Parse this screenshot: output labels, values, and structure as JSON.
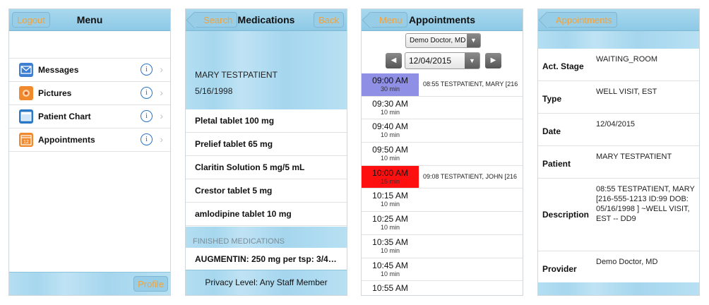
{
  "screen1": {
    "title": "Menu",
    "logout_label": "Logout",
    "profile_label": "Profile",
    "items": [
      {
        "label": "Messages",
        "icon": "envelope-icon",
        "color": "#3e7fd1"
      },
      {
        "label": "Pictures",
        "icon": "pictures-icon",
        "color": "#f08a2c"
      },
      {
        "label": "Patient Chart",
        "icon": "patient-chart-icon",
        "color": "#2b78c6"
      },
      {
        "label": "Appointments",
        "icon": "calendar-icon",
        "color": "#f0892c"
      }
    ],
    "info_glyph": "i",
    "chevron_glyph": "›"
  },
  "screen2": {
    "title": "Medications",
    "search_label": "Search",
    "back_label": "Back",
    "patient_name": "MARY TESTPATIENT",
    "patient_dob": "5/16/1998",
    "medications": [
      "Pletal tablet 100 mg",
      "Prelief tablet 65 mg",
      "Claritin Solution 5 mg/5 mL",
      "Crestor tablet 5 mg",
      "amlodipine tablet 10 mg"
    ],
    "finished_header": "FINISHED MEDICATIONS",
    "finished_item": "AUGMENTIN: 250 mg per tsp: 3/4…",
    "privacy": "Privacy Level: Any Staff Member"
  },
  "screen3": {
    "title": "Appointments",
    "back_label": "Menu",
    "doctor": "Demo Doctor, MD",
    "date": "12/04/2015",
    "prev_glyph": "◀",
    "next_glyph": "▶",
    "dropdown_glyph": "▼",
    "slots": [
      {
        "time": "09:00 AM",
        "duration": "30 min",
        "desc": "08:55 TESTPATIENT, MARY  [216",
        "highlight": "#8f8fe6"
      },
      {
        "time": "09:30 AM",
        "duration": "10 min",
        "desc": "",
        "highlight": ""
      },
      {
        "time": "09:40 AM",
        "duration": "10 min",
        "desc": "",
        "highlight": ""
      },
      {
        "time": "09:50 AM",
        "duration": "10 min",
        "desc": "",
        "highlight": ""
      },
      {
        "time": "10:00 AM",
        "duration": "15 min",
        "desc": "09:08 TESTPATIENT, JOHN  [216",
        "highlight": "#ff1010"
      },
      {
        "time": "10:15 AM",
        "duration": "10 min",
        "desc": "",
        "highlight": ""
      },
      {
        "time": "10:25 AM",
        "duration": "10 min",
        "desc": "",
        "highlight": ""
      },
      {
        "time": "10:35 AM",
        "duration": "10 min",
        "desc": "",
        "highlight": ""
      },
      {
        "time": "10:45 AM",
        "duration": "10 min",
        "desc": "",
        "highlight": ""
      },
      {
        "time": "10:55 AM",
        "duration": "",
        "desc": "",
        "highlight": ""
      }
    ]
  },
  "screen4": {
    "back_label": "Appointments",
    "rows": [
      {
        "label": "Act. Stage",
        "value": "WAITING_ROOM"
      },
      {
        "label": "Type",
        "value": "WELL VISIT, EST"
      },
      {
        "label": "Date",
        "value": "12/04/2015"
      },
      {
        "label": "Patient",
        "value": "MARY TESTPATIENT"
      },
      {
        "label": "Description",
        "value": "08:55 TESTPATIENT, MARY [216-555-1213 ID:99 DOB: 05/16/1998 ] ~WELL VISIT, EST -- DD9"
      },
      {
        "label": "Provider",
        "value": "Demo  Doctor, MD"
      }
    ]
  }
}
